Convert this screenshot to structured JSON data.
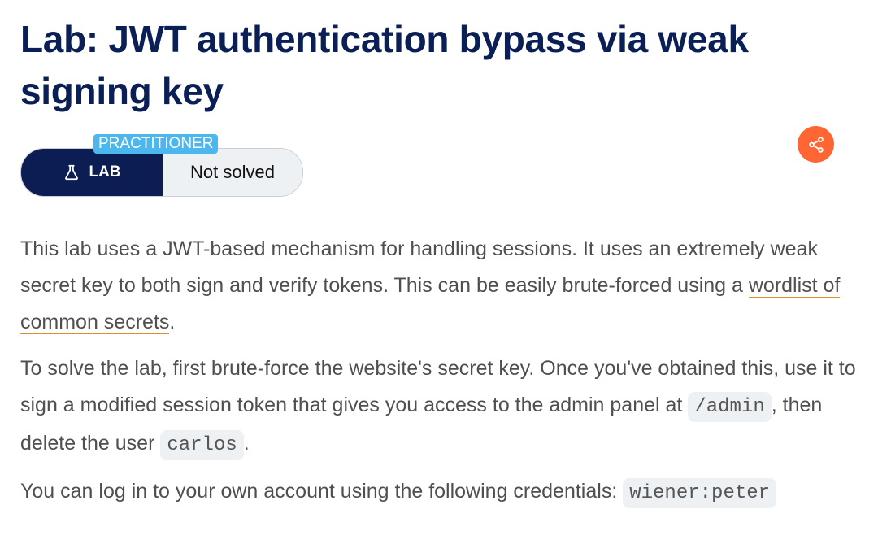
{
  "lab": {
    "title": "Lab: JWT authentication bypass via weak signing key",
    "level": "PRACTITIONER",
    "badge_label": "LAB",
    "status": "Not solved"
  },
  "icons": {
    "flask": "flask-icon",
    "share": "share-icon"
  },
  "colors": {
    "title": "#0a1f55",
    "badge_dark": "#0b1d52",
    "level": "#4cb6ee",
    "share": "#ff6633",
    "link_underline": "#d8912e"
  },
  "description": {
    "p1_before": "This lab uses a JWT-based mechanism for handling sessions. It uses an extremely weak secret key to both sign and verify tokens. This can be easily brute-forced using a ",
    "p1_link": "wordlist of common secrets",
    "p1_after": ".",
    "p2_before": "To solve the lab, first brute-force the website's secret key. Once you've obtained this, use it to sign a modified session token that gives you access to the admin panel at ",
    "p2_code1": "/admin",
    "p2_middle": ", then delete the user ",
    "p2_code2": "carlos",
    "p2_after": ".",
    "p3_text": "You can log in to your own account using the following credentials: ",
    "p3_code": "wiener:peter"
  }
}
